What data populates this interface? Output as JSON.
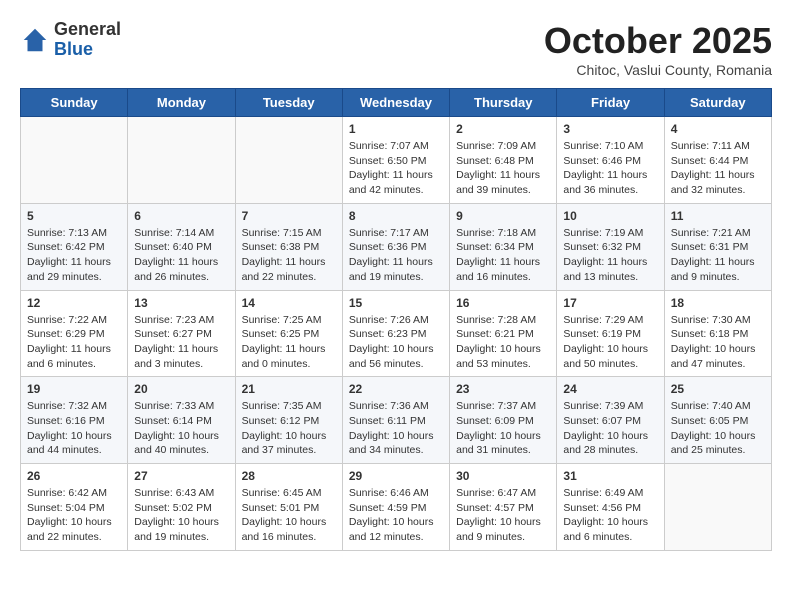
{
  "header": {
    "logo": {
      "general": "General",
      "blue": "Blue"
    },
    "title": "October 2025",
    "subtitle": "Chitoc, Vaslui County, Romania"
  },
  "weekdays": [
    "Sunday",
    "Monday",
    "Tuesday",
    "Wednesday",
    "Thursday",
    "Friday",
    "Saturday"
  ],
  "weeks": [
    [
      {
        "day": "",
        "sunrise": "",
        "sunset": "",
        "daylight": ""
      },
      {
        "day": "",
        "sunrise": "",
        "sunset": "",
        "daylight": ""
      },
      {
        "day": "",
        "sunrise": "",
        "sunset": "",
        "daylight": ""
      },
      {
        "day": "1",
        "sunrise": "Sunrise: 7:07 AM",
        "sunset": "Sunset: 6:50 PM",
        "daylight": "Daylight: 11 hours and 42 minutes."
      },
      {
        "day": "2",
        "sunrise": "Sunrise: 7:09 AM",
        "sunset": "Sunset: 6:48 PM",
        "daylight": "Daylight: 11 hours and 39 minutes."
      },
      {
        "day": "3",
        "sunrise": "Sunrise: 7:10 AM",
        "sunset": "Sunset: 6:46 PM",
        "daylight": "Daylight: 11 hours and 36 minutes."
      },
      {
        "day": "4",
        "sunrise": "Sunrise: 7:11 AM",
        "sunset": "Sunset: 6:44 PM",
        "daylight": "Daylight: 11 hours and 32 minutes."
      }
    ],
    [
      {
        "day": "5",
        "sunrise": "Sunrise: 7:13 AM",
        "sunset": "Sunset: 6:42 PM",
        "daylight": "Daylight: 11 hours and 29 minutes."
      },
      {
        "day": "6",
        "sunrise": "Sunrise: 7:14 AM",
        "sunset": "Sunset: 6:40 PM",
        "daylight": "Daylight: 11 hours and 26 minutes."
      },
      {
        "day": "7",
        "sunrise": "Sunrise: 7:15 AM",
        "sunset": "Sunset: 6:38 PM",
        "daylight": "Daylight: 11 hours and 22 minutes."
      },
      {
        "day": "8",
        "sunrise": "Sunrise: 7:17 AM",
        "sunset": "Sunset: 6:36 PM",
        "daylight": "Daylight: 11 hours and 19 minutes."
      },
      {
        "day": "9",
        "sunrise": "Sunrise: 7:18 AM",
        "sunset": "Sunset: 6:34 PM",
        "daylight": "Daylight: 11 hours and 16 minutes."
      },
      {
        "day": "10",
        "sunrise": "Sunrise: 7:19 AM",
        "sunset": "Sunset: 6:32 PM",
        "daylight": "Daylight: 11 hours and 13 minutes."
      },
      {
        "day": "11",
        "sunrise": "Sunrise: 7:21 AM",
        "sunset": "Sunset: 6:31 PM",
        "daylight": "Daylight: 11 hours and 9 minutes."
      }
    ],
    [
      {
        "day": "12",
        "sunrise": "Sunrise: 7:22 AM",
        "sunset": "Sunset: 6:29 PM",
        "daylight": "Daylight: 11 hours and 6 minutes."
      },
      {
        "day": "13",
        "sunrise": "Sunrise: 7:23 AM",
        "sunset": "Sunset: 6:27 PM",
        "daylight": "Daylight: 11 hours and 3 minutes."
      },
      {
        "day": "14",
        "sunrise": "Sunrise: 7:25 AM",
        "sunset": "Sunset: 6:25 PM",
        "daylight": "Daylight: 11 hours and 0 minutes."
      },
      {
        "day": "15",
        "sunrise": "Sunrise: 7:26 AM",
        "sunset": "Sunset: 6:23 PM",
        "daylight": "Daylight: 10 hours and 56 minutes."
      },
      {
        "day": "16",
        "sunrise": "Sunrise: 7:28 AM",
        "sunset": "Sunset: 6:21 PM",
        "daylight": "Daylight: 10 hours and 53 minutes."
      },
      {
        "day": "17",
        "sunrise": "Sunrise: 7:29 AM",
        "sunset": "Sunset: 6:19 PM",
        "daylight": "Daylight: 10 hours and 50 minutes."
      },
      {
        "day": "18",
        "sunrise": "Sunrise: 7:30 AM",
        "sunset": "Sunset: 6:18 PM",
        "daylight": "Daylight: 10 hours and 47 minutes."
      }
    ],
    [
      {
        "day": "19",
        "sunrise": "Sunrise: 7:32 AM",
        "sunset": "Sunset: 6:16 PM",
        "daylight": "Daylight: 10 hours and 44 minutes."
      },
      {
        "day": "20",
        "sunrise": "Sunrise: 7:33 AM",
        "sunset": "Sunset: 6:14 PM",
        "daylight": "Daylight: 10 hours and 40 minutes."
      },
      {
        "day": "21",
        "sunrise": "Sunrise: 7:35 AM",
        "sunset": "Sunset: 6:12 PM",
        "daylight": "Daylight: 10 hours and 37 minutes."
      },
      {
        "day": "22",
        "sunrise": "Sunrise: 7:36 AM",
        "sunset": "Sunset: 6:11 PM",
        "daylight": "Daylight: 10 hours and 34 minutes."
      },
      {
        "day": "23",
        "sunrise": "Sunrise: 7:37 AM",
        "sunset": "Sunset: 6:09 PM",
        "daylight": "Daylight: 10 hours and 31 minutes."
      },
      {
        "day": "24",
        "sunrise": "Sunrise: 7:39 AM",
        "sunset": "Sunset: 6:07 PM",
        "daylight": "Daylight: 10 hours and 28 minutes."
      },
      {
        "day": "25",
        "sunrise": "Sunrise: 7:40 AM",
        "sunset": "Sunset: 6:05 PM",
        "daylight": "Daylight: 10 hours and 25 minutes."
      }
    ],
    [
      {
        "day": "26",
        "sunrise": "Sunrise: 6:42 AM",
        "sunset": "Sunset: 5:04 PM",
        "daylight": "Daylight: 10 hours and 22 minutes."
      },
      {
        "day": "27",
        "sunrise": "Sunrise: 6:43 AM",
        "sunset": "Sunset: 5:02 PM",
        "daylight": "Daylight: 10 hours and 19 minutes."
      },
      {
        "day": "28",
        "sunrise": "Sunrise: 6:45 AM",
        "sunset": "Sunset: 5:01 PM",
        "daylight": "Daylight: 10 hours and 16 minutes."
      },
      {
        "day": "29",
        "sunrise": "Sunrise: 6:46 AM",
        "sunset": "Sunset: 4:59 PM",
        "daylight": "Daylight: 10 hours and 12 minutes."
      },
      {
        "day": "30",
        "sunrise": "Sunrise: 6:47 AM",
        "sunset": "Sunset: 4:57 PM",
        "daylight": "Daylight: 10 hours and 9 minutes."
      },
      {
        "day": "31",
        "sunrise": "Sunrise: 6:49 AM",
        "sunset": "Sunset: 4:56 PM",
        "daylight": "Daylight: 10 hours and 6 minutes."
      },
      {
        "day": "",
        "sunrise": "",
        "sunset": "",
        "daylight": ""
      }
    ]
  ]
}
